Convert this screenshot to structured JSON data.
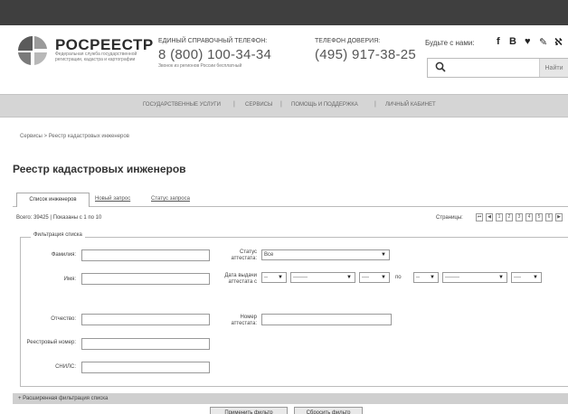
{
  "header": {
    "logo_title": "РОСРЕЕСТР",
    "logo_subtitle": "Федеральная служба государственной регистрации, кадастра и картографии",
    "hotline_label": "ЕДИНЫЙ СПРАВОЧНЫЙ ТЕЛЕФОН:",
    "hotline_number": "8 (800) 100-34-34",
    "hotline_note": "Звонок из регионов России бесплатный",
    "trust_label": "ТЕЛЕФОН ДОВЕРИЯ:",
    "trust_number": "(495) 917-38-25",
    "social_label": "Будьте с нами:",
    "social_icons": [
      "facebook-icon",
      "vk-icon",
      "twitter-icon",
      "odnoklassniki-icon",
      "livejournal-icon"
    ],
    "social_glyphs": [
      "f",
      "В",
      "♥",
      "✎",
      "ℵ"
    ],
    "search_placeholder": "",
    "search_button": "Найти"
  },
  "nav": {
    "items": [
      "ГОСУДАРСТВЕННЫЕ УСЛУГИ",
      "СЕРВИСЫ",
      "ПОМОЩЬ И ПОДДЕРЖКА",
      "ЛИЧНЫЙ КАБИНЕТ"
    ],
    "separator": "|"
  },
  "breadcrumb": "Сервисы  >  Реестр кадастровых инженеров",
  "page_title": "Реестр кадастровых инженеров",
  "tabs": [
    "Список инженеров",
    "Новый запрос",
    "Статус запроса"
  ],
  "results": {
    "total": "Всего: 39425 | Показаны с 1 по 10",
    "pages_label": "Страницы:",
    "pager": [
      "⏮",
      "◀",
      "1",
      "2",
      "3",
      "4",
      "5",
      "6",
      "▶"
    ]
  },
  "filter": {
    "legend": "Фильтрация списка",
    "labels": {
      "surname": "Фамилия:",
      "name": "Имя:",
      "patronymic": "Отчество:",
      "registry_number": "Реестровый номер:",
      "snils": "СНИЛС:",
      "status": "Статус аттестата:",
      "issue_date": "Дата выдачи аттестата с",
      "to": "по",
      "cert_number": "Номер аттестата:"
    },
    "status_value": "Все",
    "date_from": {
      "day": "--",
      "month": "--------",
      "year": "----"
    },
    "date_to": {
      "day": "--",
      "month": "--------",
      "year": "----"
    }
  },
  "extended_filter": "+ Расширенная фильтрация списка",
  "buttons": [
    "Применить фильтр",
    "Сбросить фильтр"
  ],
  "colors": {
    "topbar": "#3f3f3f",
    "nav": "#d5d5d5",
    "logo_red": "#8c8c8c"
  }
}
